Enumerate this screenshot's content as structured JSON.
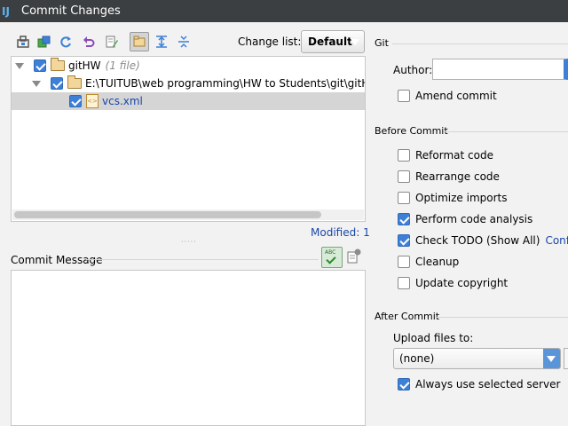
{
  "window": {
    "title": "Commit Changes"
  },
  "toolbar": {
    "icons": [
      "show-diff-icon",
      "move-to-changelist-icon",
      "refresh-icon",
      "revert-icon",
      "edit-source-icon",
      "group-by-directory-icon",
      "expand-all-icon",
      "collapse-all-icon"
    ],
    "change_list_label": "Change list:",
    "change_list_value": "Default"
  },
  "tree": {
    "root": {
      "label": "gitHW",
      "count": "(1 file)"
    },
    "folder": {
      "label": "E:\\TUITUB\\web programming\\HW to Students\\git\\gitHW\\.id"
    },
    "file": {
      "label": "vcs.xml"
    }
  },
  "modified": "Modified: 1",
  "commit_message": {
    "label": "Commit Message",
    "value": ""
  },
  "git": {
    "title": "Git",
    "author_label": "Author:",
    "author_value": "",
    "amend_label": "Amend commit",
    "amend_checked": false
  },
  "before_commit": {
    "title": "Before Commit",
    "options": [
      {
        "label": "Reformat code",
        "checked": false
      },
      {
        "label": "Rearrange code",
        "checked": false
      },
      {
        "label": "Optimize imports",
        "checked": false
      },
      {
        "label": "Perform code analysis",
        "checked": true
      },
      {
        "label": "Check TODO (Show All)",
        "checked": true,
        "link": "Configu"
      },
      {
        "label": "Cleanup",
        "checked": false
      },
      {
        "label": "Update copyright",
        "checked": false
      }
    ]
  },
  "after_commit": {
    "title": "After Commit",
    "upload_label": "Upload files to:",
    "upload_value": "(none)",
    "always_label": "Always use selected server",
    "always_checked": true
  },
  "colors": {
    "titlebar": "#3c3f41",
    "accent": "#3d80d6",
    "link": "#1a47a8",
    "selection": "#d5d5d5"
  }
}
